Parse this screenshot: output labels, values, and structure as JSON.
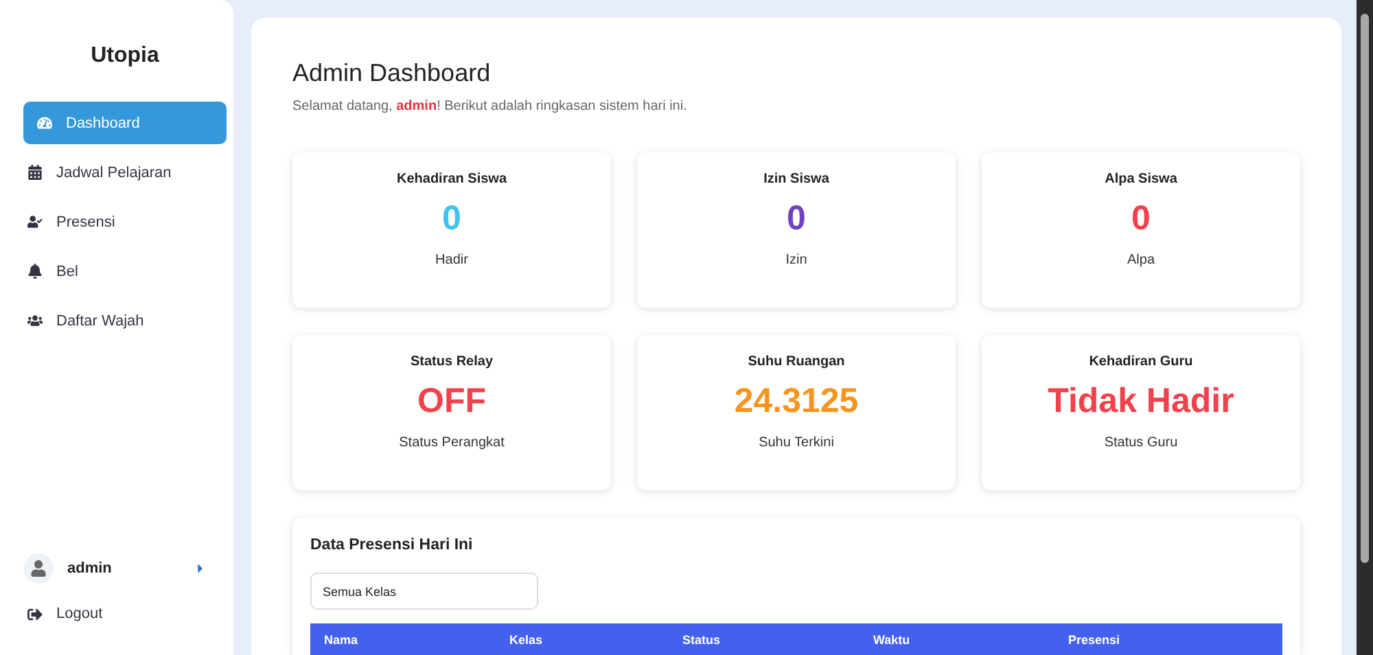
{
  "sidebar": {
    "brand": "Utopia",
    "items": [
      {
        "label": "Dashboard",
        "kind": "dashboard",
        "selected": true
      },
      {
        "label": "Jadwal Pelajaran",
        "kind": "schedule",
        "selected": false
      },
      {
        "label": "Presensi",
        "kind": "attendance",
        "selected": false
      },
      {
        "label": "Bel",
        "kind": "bell",
        "selected": false
      },
      {
        "label": "Daftar Wajah",
        "kind": "faces",
        "selected": false
      }
    ],
    "user": {
      "name": "admin"
    },
    "logout": "Logout"
  },
  "header": {
    "title": "Admin Dashboard",
    "subtitle": "Selamat datang, **admin**! Berikut adalah ringkasan sistem hari ini."
  },
  "stats": [
    {
      "title": "Kehadiran Siswa",
      "value": "0",
      "caption": "Hadir",
      "color": "#3dc3ee"
    },
    {
      "title": "Izin Siswa",
      "value": "0",
      "caption": "Izin",
      "color": "#6f42c1"
    },
    {
      "title": "Alpa Siswa",
      "value": "0",
      "caption": "Alpa",
      "color": "#f1414b"
    },
    {
      "title": "Status Relay",
      "value": "OFF",
      "caption": "Status Perangkat",
      "color": "#f1414b"
    },
    {
      "title": "Suhu Ruangan",
      "value": "24.3125",
      "caption": "Suhu Terkini",
      "color": "#f8941e"
    },
    {
      "title": "Kehadiran Guru",
      "value": "Tidak Hadir",
      "caption": "Status Guru",
      "color": "#f1414b"
    }
  ],
  "attendance": {
    "title": "Data Presensi Hari Ini",
    "filter": "Semua Kelas",
    "columns": [
      "Nama",
      "Kelas",
      "Status",
      "Waktu",
      "Presensi"
    ]
  }
}
